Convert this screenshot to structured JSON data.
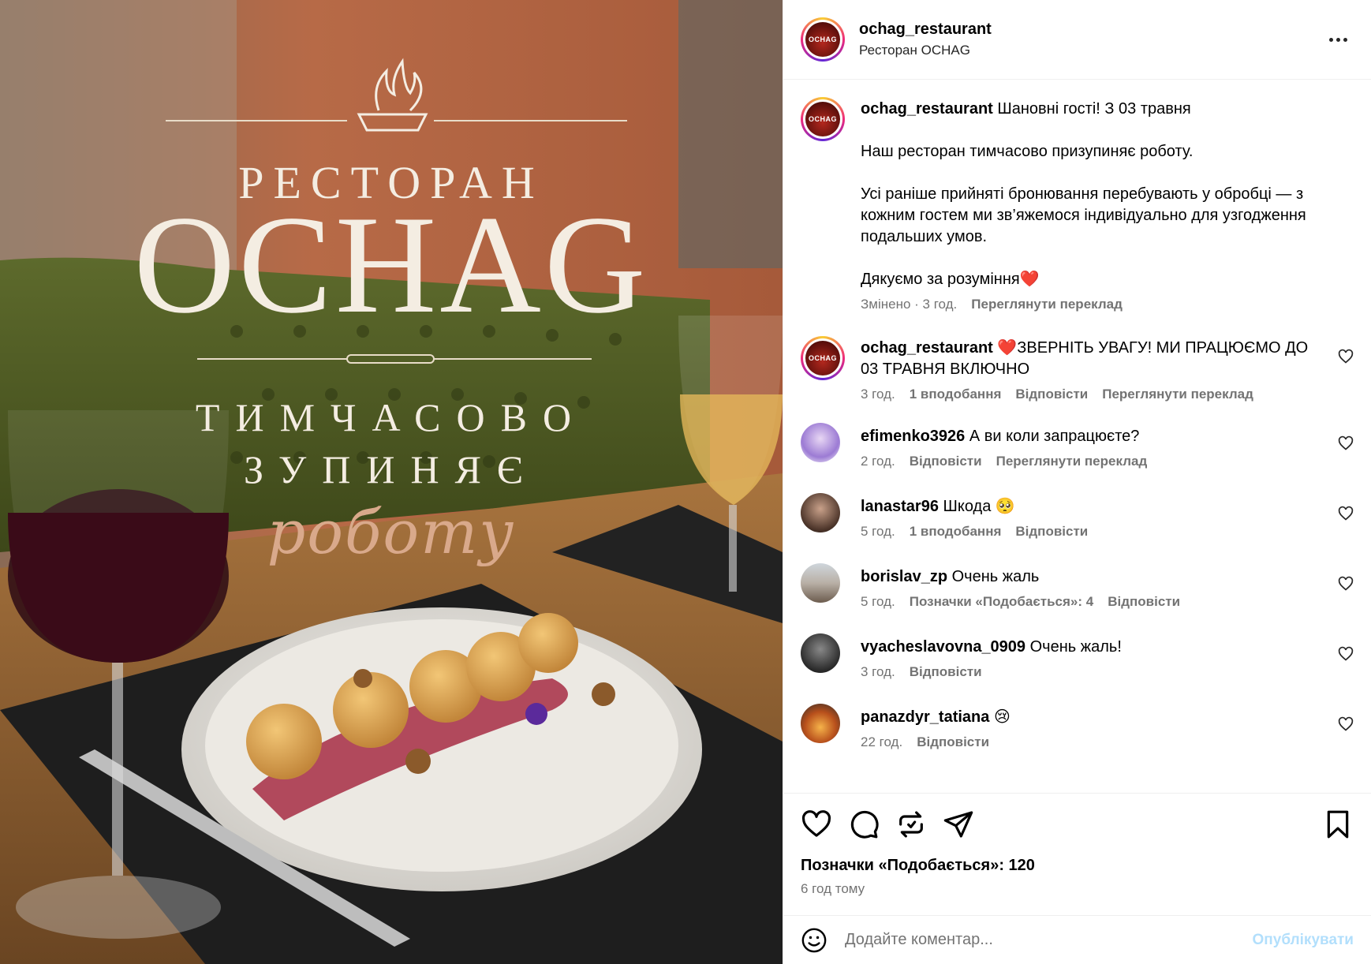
{
  "post_image": {
    "overlay": {
      "restoran": "РЕСТОРАН",
      "ochag": "OCHAG",
      "line1": "ТИМЧАСОВО",
      "line2": "ЗУПИНЯЄ",
      "script": "роботу"
    }
  },
  "header": {
    "username": "ochag_restaurant",
    "subtitle": "Ресторан OCHAG",
    "avatar_text": "OCHAG"
  },
  "caption": {
    "username": "ochag_restaurant",
    "line1": "Шановні гості! З 03 травня",
    "p2": "Наш ресторан тимчасово призупиняє роботу.",
    "p3": "Усі раніше прийняті бронювання перебувають у обробці — з кожним гостем ми зв’яжемося індивідуально для узгодження подальших умов.",
    "p4": "Дякуємо за розуміння❤️",
    "edited": "Змінено · 3 год.",
    "translate": "Переглянути переклад"
  },
  "comments": [
    {
      "username": "ochag_restaurant",
      "text": "❤️ЗВЕРНІТЬ УВАГУ! МИ ПРАЦЮЄМО ДО 03 ТРАВНЯ ВКЛЮЧНО",
      "time": "3 год.",
      "likes": "1 вподобання",
      "reply": "Відповісти",
      "translate": "Переглянути переклад"
    },
    {
      "username": "efimenko3926",
      "text": "А ви коли запрацюєте?",
      "time": "2 год.",
      "reply": "Відповісти",
      "translate": "Переглянути переклад"
    },
    {
      "username": "lanastar96",
      "text": "Шкода 🥺",
      "time": "5 год.",
      "likes": "1 вподобання",
      "reply": "Відповісти"
    },
    {
      "username": "borislav_zp",
      "text": "Очень жаль",
      "time": "5 год.",
      "likes": "Позначки «Подобається»: 4",
      "reply": "Відповісти"
    },
    {
      "username": "vyacheslavovna_0909",
      "text": "Очень жаль!",
      "time": "3 год.",
      "reply": "Відповісти"
    },
    {
      "username": "panazdyr_tatiana",
      "text": "😢",
      "time": "22 год.",
      "reply": "Відповісти"
    }
  ],
  "actions": {
    "icons": [
      "heart-icon",
      "comment-icon",
      "repost-icon",
      "share-icon",
      "bookmark-icon"
    ],
    "likes": "Позначки «Подобається»: 120",
    "time_ago": "6 год тому"
  },
  "add_comment": {
    "placeholder": "Додайте коментар...",
    "publish": "Опублікувати"
  },
  "colors": {
    "muted": "#737373",
    "publish_disabled": "#b2dffc",
    "divider": "#efefef"
  }
}
